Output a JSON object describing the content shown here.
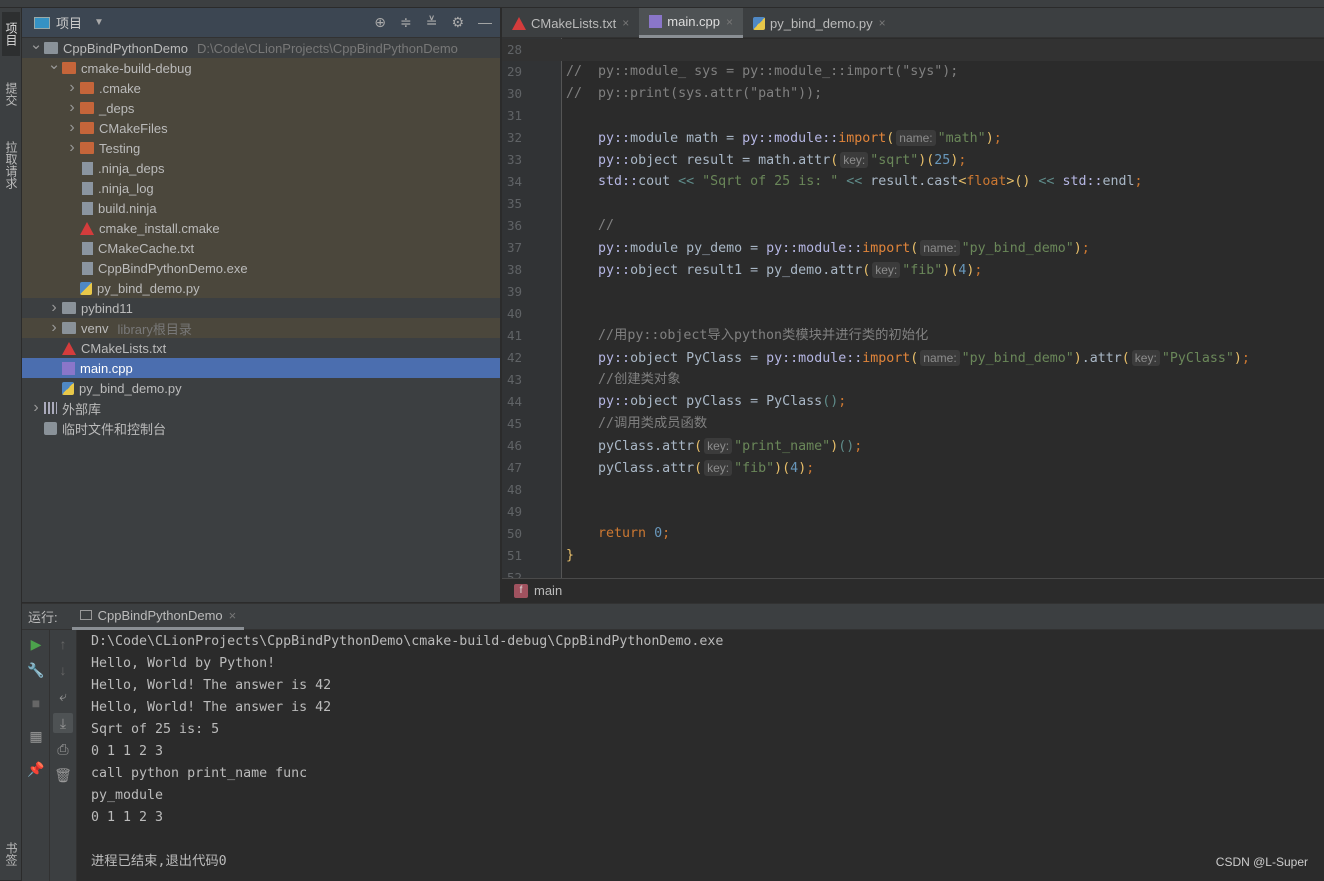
{
  "left_strip": {
    "labels": [
      "项目",
      "提交",
      "拉取请求",
      "书签"
    ]
  },
  "project": {
    "title": "项目",
    "tree": [
      {
        "depth": 0,
        "chev": "v",
        "icon": "folder-gray",
        "label": "CppBindPythonDemo",
        "hint": "D:\\Code\\CLionProjects\\CppBindPythonDemo",
        "bg": ""
      },
      {
        "depth": 1,
        "chev": "v",
        "icon": "folder-orange",
        "label": "cmake-build-debug",
        "hint": "",
        "bg": "olive"
      },
      {
        "depth": 2,
        "chev": ">",
        "icon": "folder-orange",
        "label": ".cmake",
        "hint": "",
        "bg": "olive"
      },
      {
        "depth": 2,
        "chev": ">",
        "icon": "folder-orange",
        "label": "_deps",
        "hint": "",
        "bg": "olive"
      },
      {
        "depth": 2,
        "chev": ">",
        "icon": "folder-orange",
        "label": "CMakeFiles",
        "hint": "",
        "bg": "olive"
      },
      {
        "depth": 2,
        "chev": ">",
        "icon": "folder-orange",
        "label": "Testing",
        "hint": "",
        "bg": "olive"
      },
      {
        "depth": 2,
        "chev": "",
        "icon": "file",
        "label": ".ninja_deps",
        "hint": "",
        "bg": "olive"
      },
      {
        "depth": 2,
        "chev": "",
        "icon": "file",
        "label": ".ninja_log",
        "hint": "",
        "bg": "olive"
      },
      {
        "depth": 2,
        "chev": "",
        "icon": "file",
        "label": "build.ninja",
        "hint": "",
        "bg": "olive"
      },
      {
        "depth": 2,
        "chev": "",
        "icon": "cmake",
        "label": "cmake_install.cmake",
        "hint": "",
        "bg": "olive"
      },
      {
        "depth": 2,
        "chev": "",
        "icon": "file",
        "label": "CMakeCache.txt",
        "hint": "",
        "bg": "olive"
      },
      {
        "depth": 2,
        "chev": "",
        "icon": "file",
        "label": "CppBindPythonDemo.exe",
        "hint": "",
        "bg": "olive"
      },
      {
        "depth": 2,
        "chev": "",
        "icon": "py",
        "label": "py_bind_demo.py",
        "hint": "",
        "bg": "olive"
      },
      {
        "depth": 1,
        "chev": ">",
        "icon": "folder-gray",
        "label": "pybind11",
        "hint": "",
        "bg": ""
      },
      {
        "depth": 1,
        "chev": ">",
        "icon": "folder-gray",
        "label": "venv",
        "hint": "library根目录",
        "bg": "olive"
      },
      {
        "depth": 1,
        "chev": "",
        "icon": "cmake",
        "label": "CMakeLists.txt",
        "hint": "",
        "bg": ""
      },
      {
        "depth": 1,
        "chev": "",
        "icon": "cpp",
        "label": "main.cpp",
        "hint": "",
        "bg": "sel"
      },
      {
        "depth": 1,
        "chev": "",
        "icon": "py",
        "label": "py_bind_demo.py",
        "hint": "",
        "bg": ""
      },
      {
        "depth": 0,
        "chev": ">",
        "icon": "lib",
        "label": "外部库",
        "hint": "",
        "bg": ""
      },
      {
        "depth": 0,
        "chev": "",
        "icon": "scratch",
        "label": "临时文件和控制台",
        "hint": "",
        "bg": ""
      }
    ]
  },
  "editor": {
    "tabs": [
      {
        "label": "CMakeLists.txt",
        "icon": "cmake",
        "active": false
      },
      {
        "label": "main.cpp",
        "icon": "cpp",
        "active": true
      },
      {
        "label": "py_bind_demo.py",
        "icon": "py",
        "active": false
      }
    ],
    "lines": [
      {
        "n": "28",
        "t": []
      },
      {
        "n": "29",
        "t": [
          [
            "c",
            "//  py::module_ sys = py::module_::import(\"sys\");"
          ]
        ]
      },
      {
        "n": "30",
        "t": [
          [
            "c",
            "//  py::print(sys.attr(\"path\"));"
          ]
        ]
      },
      {
        "n": "31",
        "t": []
      },
      {
        "n": "32",
        "t": [
          [
            "i",
            "    "
          ],
          [
            "n",
            "py::"
          ],
          [
            "i",
            "module math = "
          ],
          [
            "n",
            "py::module::"
          ],
          [
            "f",
            "import"
          ],
          [
            "p",
            "("
          ],
          [
            "h",
            "name:"
          ],
          [
            "s",
            "\"math\""
          ],
          [
            "p",
            ")"
          ],
          [
            "q",
            ";"
          ]
        ]
      },
      {
        "n": "33",
        "t": [
          [
            "i",
            "    "
          ],
          [
            "n",
            "py::"
          ],
          [
            "i",
            "object result = math.attr"
          ],
          [
            "p",
            "("
          ],
          [
            "h",
            "key:"
          ],
          [
            "s",
            "\"sqrt\""
          ],
          [
            "p",
            ")("
          ],
          [
            "num",
            "25"
          ],
          [
            "p",
            ")"
          ],
          [
            "q",
            ";"
          ]
        ]
      },
      {
        "n": "34",
        "t": [
          [
            "i",
            "    "
          ],
          [
            "n",
            "std::"
          ],
          [
            "i",
            "cout "
          ],
          [
            "o",
            "<<"
          ],
          [
            "i",
            " "
          ],
          [
            "s",
            "\"Sqrt of 25 is: \""
          ],
          [
            "i",
            " "
          ],
          [
            "o",
            "<<"
          ],
          [
            "i",
            " result.cast"
          ],
          [
            "p",
            "<"
          ],
          [
            "k",
            "float"
          ],
          [
            "p",
            ">()"
          ],
          [
            "i",
            " "
          ],
          [
            "o",
            "<<"
          ],
          [
            "i",
            " "
          ],
          [
            "n",
            "std::"
          ],
          [
            "i",
            "endl"
          ],
          [
            "q",
            ";"
          ]
        ]
      },
      {
        "n": "35",
        "t": []
      },
      {
        "n": "36",
        "t": [
          [
            "i",
            "    "
          ],
          [
            "c",
            "//"
          ]
        ]
      },
      {
        "n": "37",
        "t": [
          [
            "i",
            "    "
          ],
          [
            "n",
            "py::"
          ],
          [
            "i",
            "module py_demo = "
          ],
          [
            "n",
            "py::module::"
          ],
          [
            "f",
            "import"
          ],
          [
            "p",
            "("
          ],
          [
            "h",
            "name:"
          ],
          [
            "s",
            "\"py_bind_demo\""
          ],
          [
            "p",
            ")"
          ],
          [
            "q",
            ";"
          ]
        ]
      },
      {
        "n": "38",
        "t": [
          [
            "i",
            "    "
          ],
          [
            "n",
            "py::"
          ],
          [
            "i",
            "object result1 = py_demo.attr"
          ],
          [
            "p",
            "("
          ],
          [
            "h",
            "key:"
          ],
          [
            "s",
            "\"fib\""
          ],
          [
            "p",
            ")("
          ],
          [
            "num",
            "4"
          ],
          [
            "p",
            ")"
          ],
          [
            "q",
            ";"
          ]
        ]
      },
      {
        "n": "39",
        "t": []
      },
      {
        "n": "40",
        "t": []
      },
      {
        "n": "41",
        "t": [
          [
            "i",
            "    "
          ],
          [
            "c",
            "//用py::object导入python类模块并进行类的初始化"
          ]
        ]
      },
      {
        "n": "42",
        "t": [
          [
            "i",
            "    "
          ],
          [
            "n",
            "py::"
          ],
          [
            "i",
            "object PyClass = "
          ],
          [
            "n",
            "py::module::"
          ],
          [
            "f",
            "import"
          ],
          [
            "p",
            "("
          ],
          [
            "h",
            "name:"
          ],
          [
            "s",
            "\"py_bind_demo\""
          ],
          [
            "p",
            ")"
          ],
          [
            "i",
            ".attr"
          ],
          [
            "p",
            "("
          ],
          [
            "h",
            "key:"
          ],
          [
            "s",
            "\"PyClass\""
          ],
          [
            "p",
            ")"
          ],
          [
            "q",
            ";"
          ]
        ]
      },
      {
        "n": "43",
        "t": [
          [
            "i",
            "    "
          ],
          [
            "c",
            "//创建类对象"
          ]
        ]
      },
      {
        "n": "44",
        "t": [
          [
            "i",
            "    "
          ],
          [
            "n",
            "py::"
          ],
          [
            "i",
            "object pyClass = PyClass"
          ],
          [
            "o",
            "()"
          ],
          [
            "q",
            ";"
          ]
        ]
      },
      {
        "n": "45",
        "t": [
          [
            "i",
            "    "
          ],
          [
            "c",
            "//调用类成员函数"
          ]
        ]
      },
      {
        "n": "46",
        "t": [
          [
            "i",
            "    pyClass.attr"
          ],
          [
            "p",
            "("
          ],
          [
            "h",
            "key:"
          ],
          [
            "s",
            "\"print_name\""
          ],
          [
            "p",
            ")"
          ],
          [
            "o",
            "()"
          ],
          [
            "q",
            ";"
          ]
        ]
      },
      {
        "n": "47",
        "t": [
          [
            "i",
            "    pyClass.attr"
          ],
          [
            "p",
            "("
          ],
          [
            "h",
            "key:"
          ],
          [
            "s",
            "\"fib\""
          ],
          [
            "p",
            ")("
          ],
          [
            "num",
            "4"
          ],
          [
            "p",
            ")"
          ],
          [
            "q",
            ";"
          ]
        ]
      },
      {
        "n": "48",
        "t": []
      },
      {
        "n": "49",
        "t": []
      },
      {
        "n": "50",
        "t": [
          [
            "i",
            "    "
          ],
          [
            "k",
            "return "
          ],
          [
            "num",
            "0"
          ],
          [
            "q",
            ";"
          ]
        ]
      },
      {
        "n": "51",
        "t": [
          [
            "p",
            "}"
          ]
        ]
      },
      {
        "n": "52",
        "t": []
      }
    ],
    "breadcrumb": {
      "badge": "f",
      "label": "main"
    }
  },
  "run": {
    "label": "运行:",
    "tab": "CppBindPythonDemo",
    "output": [
      "D:\\Code\\CLionProjects\\CppBindPythonDemo\\cmake-build-debug\\CppBindPythonDemo.exe",
      "Hello, World by Python!",
      "Hello, World! The answer is 42",
      "Hello, World! The answer is 42",
      "Sqrt of 25 is: 5",
      "0 1 1 2 3",
      "call python print_name func",
      "py_module",
      "0 1 1 2 3",
      "",
      "进程已结束,退出代码0"
    ]
  },
  "watermark": "CSDN @L-Super"
}
